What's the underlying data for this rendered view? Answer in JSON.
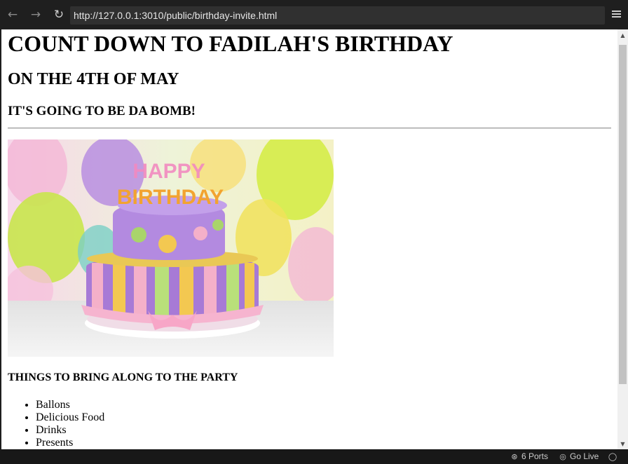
{
  "browser": {
    "url": "http://127.0.0.1:3010/public/birthday-invite.html",
    "back_icon": "arrow-left-icon",
    "forward_icon": "arrow-right-icon",
    "reload_icon": "reload-icon",
    "menu_icon": "hamburger-menu-icon"
  },
  "page": {
    "heading1": "COUNT DOWN TO FADILAH'S BIRTHDAY",
    "heading2": "ON THE 4TH OF MAY",
    "heading3": "IT'S GOING TO BE DA BOMB!",
    "image_icon": "birthday-cake-photo",
    "list_heading": "THINGS TO BRING ALONG TO THE PARTY",
    "items": [
      "Ballons",
      "Delicious Food",
      "Drinks",
      "Presents"
    ]
  },
  "statusbar": {
    "ports_label": "6 Ports",
    "golive_label": "Go Live",
    "ports_icon": "antenna-icon",
    "golive_icon": "broadcast-icon",
    "bell_icon": "bell-icon"
  },
  "colors": {
    "chrome": "#1f1f1f",
    "statusbar": "#181818",
    "page_bg": "#ffffff"
  }
}
